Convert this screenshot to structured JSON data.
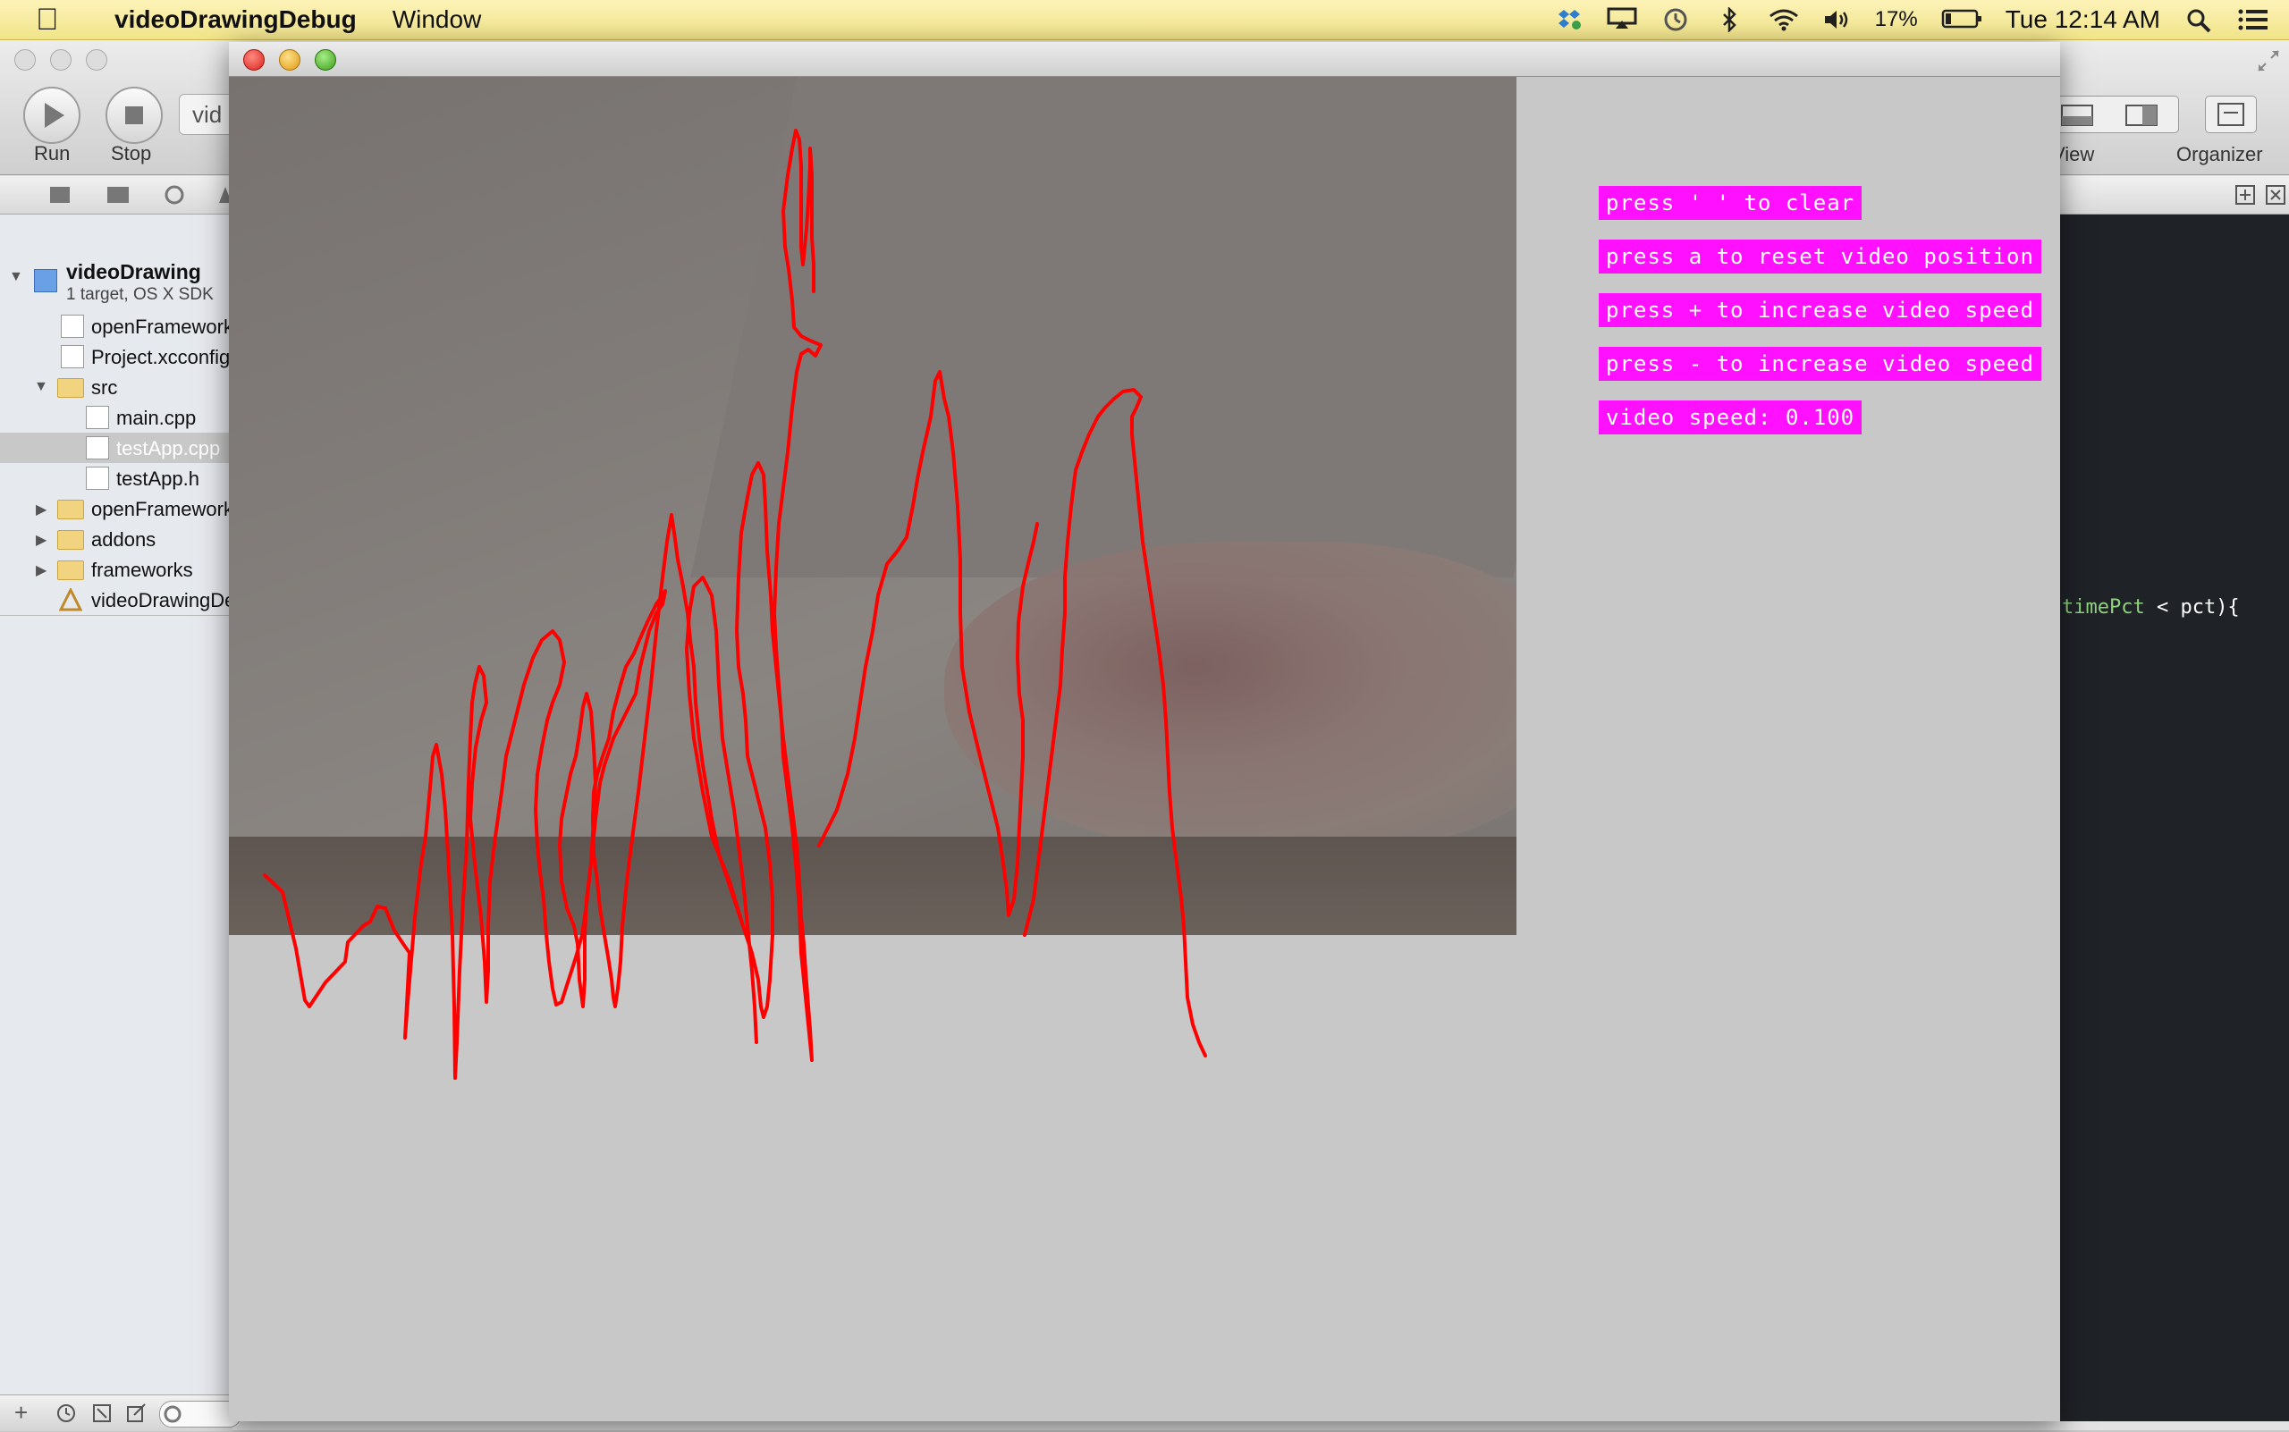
{
  "menubar": {
    "app_name": "videoDrawingDebug",
    "menus": [
      "Window"
    ],
    "status": {
      "battery": "17%",
      "clock": "Tue 12:14 AM"
    },
    "icons": [
      "apple-logo",
      "dropbox-icon",
      "airplay-icon",
      "time-machine-icon",
      "bluetooth-icon",
      "wifi-icon",
      "volume-icon",
      "battery-icon",
      "spotlight-icon",
      "notification-center-icon"
    ]
  },
  "xcode": {
    "toolbar": {
      "run_label": "Run",
      "stop_label": "Stop",
      "scheme_text": "vid",
      "view_label": "View",
      "organizer_label": "Organizer"
    },
    "navigator": {
      "project": {
        "name": "videoDrawing",
        "subtitle": "1 target, OS X SDK"
      },
      "items": [
        {
          "label": "openFrameworks"
        },
        {
          "label": "Project.xcconfig"
        },
        {
          "label": "src"
        },
        {
          "label": "main.cpp"
        },
        {
          "label": "testApp.cpp"
        },
        {
          "label": "testApp.h"
        },
        {
          "label": "openFrameworks"
        },
        {
          "label": "addons"
        },
        {
          "label": "frameworks"
        },
        {
          "label": "videoDrawingDebug"
        }
      ]
    },
    "editor": {
      "code_ident": "timePct",
      "code_rest": " < pct){"
    }
  },
  "app_window": {
    "info_lines": [
      "press ' ' to clear",
      "press a to reset video position",
      "press + to increase video speed",
      "press - to increase video speed",
      "video speed: 0.100"
    ],
    "stroke_color": "#ff0000",
    "label_bg_color": "#ff10ff"
  }
}
